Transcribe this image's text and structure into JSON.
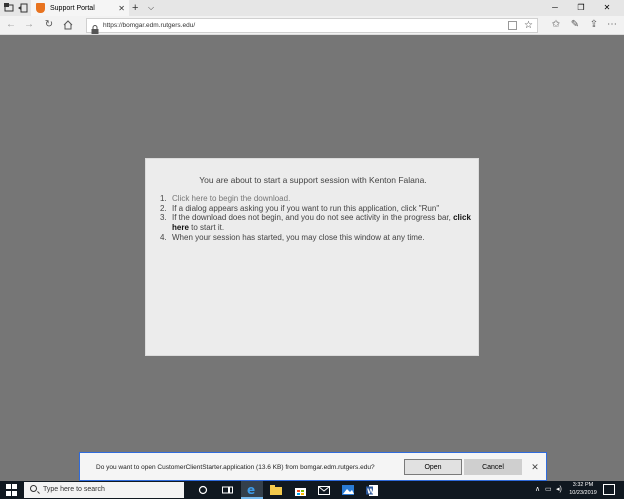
{
  "browser": {
    "tab_title": "Support Portal",
    "tab_close": "✕",
    "new_tab": "+",
    "tab_menu": "⌵",
    "address": "https://bomgar.edm.rutgers.edu/",
    "window": {
      "minimize": "─",
      "maximize": "❐",
      "close": "✕"
    }
  },
  "dialog": {
    "heading": "You are about to start a support session with Kenton Falana.",
    "steps": [
      {
        "num": "1.",
        "link": "Click here to begin the download."
      },
      {
        "num": "2.",
        "text": "If a dialog appears asking you if you want to run this application, click \"Run\""
      },
      {
        "num": "3.",
        "text_before": "If the download does not begin, and you do not see activity in the progress bar,",
        "bold": "click here",
        "text_after": "to start it."
      },
      {
        "num": "4.",
        "text": "When your session has started, you may close this window at any time."
      }
    ]
  },
  "download_bar": {
    "message": "Do you want to open CustomerClientStarter.application (13.6 KB) from bomgar.edm.rutgers.edu?",
    "open_label": "Open",
    "cancel_label": "Cancel",
    "close": "✕"
  },
  "taskbar": {
    "search_placeholder": "Type here to search",
    "time": "3:32 PM",
    "date": "10/23/2019"
  },
  "colors": {
    "page_background": "#767676",
    "dialog_background": "#ececec",
    "download_border": "#2f6bdc",
    "taskbar": "#101820",
    "tab_favicon": "#e8731f"
  }
}
